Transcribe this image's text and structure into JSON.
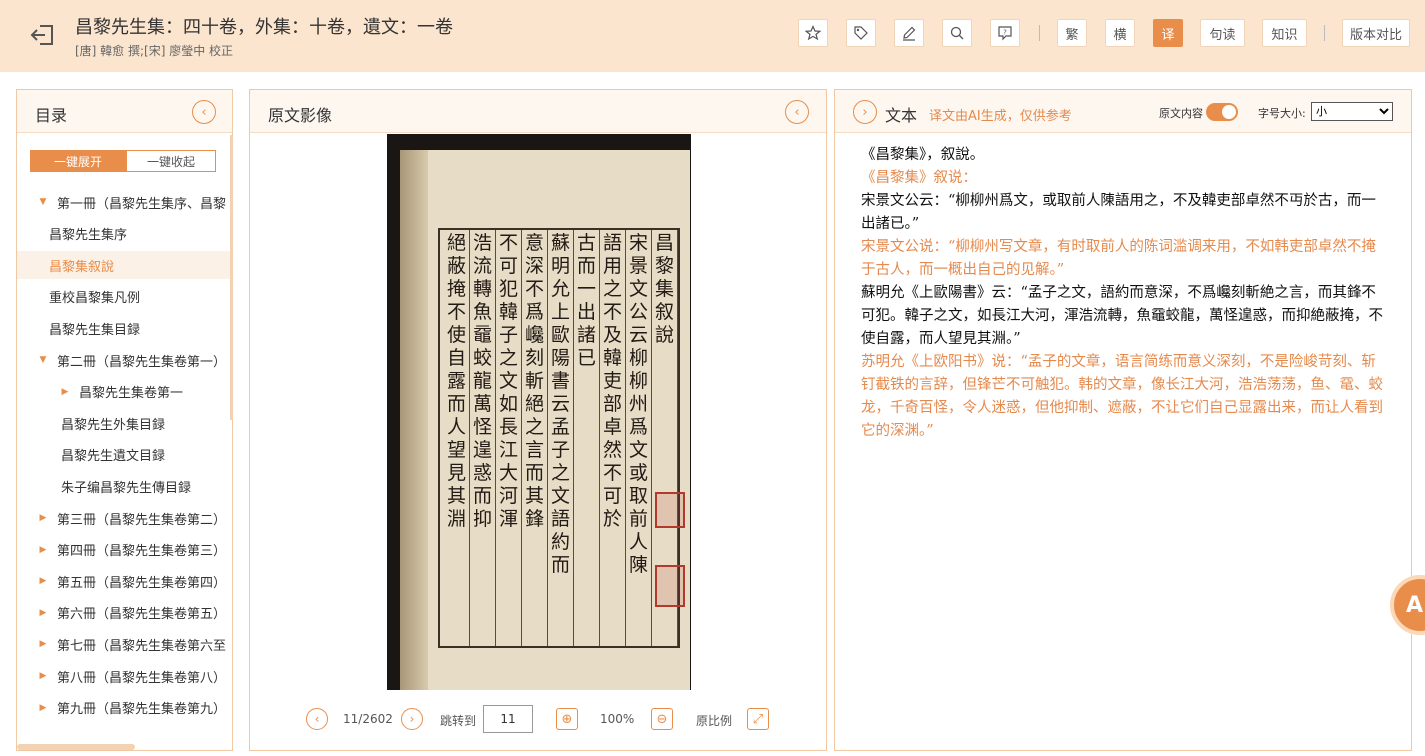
{
  "header": {
    "title": "昌黎先生集：四十卷，外集：十卷，遺文：一卷",
    "subtitle": "[唐] 韓愈 撰;[宋] 廖瑩中 校正",
    "toolbar": {
      "traditional": "繁",
      "horizontal": "横",
      "translate": "译",
      "punctuate": "句读",
      "knowledge": "知识",
      "compare": "版本对比"
    }
  },
  "toc": {
    "title": "目录",
    "expand_all": "一键展开",
    "collapse_all": "一键收起",
    "items": [
      {
        "label": "第一冊（昌黎先生集序、昌黎",
        "level": 0,
        "caret": "down"
      },
      {
        "label": "昌黎先生集序",
        "level": 1,
        "caret": ""
      },
      {
        "label": "昌黎集叙說",
        "level": 1,
        "caret": "",
        "selected": true
      },
      {
        "label": "重校昌黎集凡例",
        "level": 1,
        "caret": ""
      },
      {
        "label": "昌黎先生集目録",
        "level": 1,
        "caret": ""
      },
      {
        "label": "第二冊（昌黎先生集卷第一）",
        "level": 0,
        "caret": "down"
      },
      {
        "label": "昌黎先生集卷第一",
        "level": 2,
        "caret": "right"
      },
      {
        "label": "昌黎先生外集目録",
        "level": 2,
        "caret": ""
      },
      {
        "label": "昌黎先生遺文目録",
        "level": 2,
        "caret": ""
      },
      {
        "label": "朱子编昌黎先生傳目録",
        "level": 2,
        "caret": ""
      },
      {
        "label": "第三冊（昌黎先生集卷第二）",
        "level": 0,
        "caret": "right"
      },
      {
        "label": "第四冊（昌黎先生集卷第三）",
        "level": 0,
        "caret": "right"
      },
      {
        "label": "第五冊（昌黎先生集卷第四）",
        "level": 0,
        "caret": "right"
      },
      {
        "label": "第六冊（昌黎先生集卷第五）",
        "level": 0,
        "caret": "right"
      },
      {
        "label": "第七冊（昌黎先生集卷第六至",
        "level": 0,
        "caret": "right"
      },
      {
        "label": "第八冊（昌黎先生集卷第八）",
        "level": 0,
        "caret": "right"
      },
      {
        "label": "第九冊（昌黎先生集卷第九）",
        "level": 0,
        "caret": "right"
      }
    ]
  },
  "image_panel": {
    "title": "原文影像",
    "scan_columns": [
      "昌黎集叙說",
      "宋景文公云柳柳州爲文或取前人陳",
      "語用之不及韓吏部卓然不可於",
      "古而一出諸已",
      "蘇明允上歐陽書云孟子之文語約而",
      "意深不爲巉刻斬絕之言而其鋒",
      "不可犯韓子之文如長江大河渾",
      "浩流轉魚黿蛟龍萬怪遑惑而抑",
      "絕蔽掩不使自露而人望見其淵"
    ],
    "page_indicator": "11/2602",
    "jump_label": "跳转到",
    "jump_value": "11",
    "zoom": "100%",
    "original_scale": "原比例"
  },
  "text_panel": {
    "title": "文本",
    "notice": "译文由AI生成，仅供参考",
    "toggle_label": "原文内容",
    "toggle_on": true,
    "font_size_label": "字号大小:",
    "font_size_value": "小",
    "paragraphs": [
      {
        "type": "orig",
        "text": "《昌黎集》，叙說。"
      },
      {
        "type": "trans",
        "text": "《昌黎集》叙说："
      },
      {
        "type": "orig",
        "text": "宋景文公云：“柳柳州爲文，或取前人陳語用之，不及韓吏部卓然不丏於古，而一出諸已。”"
      },
      {
        "type": "trans",
        "text": "宋景文公说：“柳柳州写文章，有时取前人的陈词滥调来用，不如韩吏部卓然不掩于古人，而一概出自己的见解。”"
      },
      {
        "type": "orig",
        "text": "蘇明允《上歐陽書》云：“孟子之文，語約而意深，不爲巉刻斬絶之言，而其鋒不可犯。韓子之文，如長江大河，渾浩流轉，魚黿蛟龍，萬怪遑惑，而抑絶蔽掩，不使自露，而人望見其淵。”"
      },
      {
        "type": "trans",
        "text": "苏明允《上欧阳书》说：“孟子的文章，语言简练而意义深刻，不是险峻苛刻、斩钉截铁的言辞，但锋芒不可触犯。韩的文章，像长江大河，浩浩荡荡，鱼、鼋、蛟龙，千奇百怪，令人迷惑，但他抑制、遮蔽，不让它们自己显露出来，而让人看到它的深渊。”"
      }
    ]
  },
  "ai_badge": "AI",
  "colors": {
    "accent": "#e98d4a",
    "header_bg": "#fbe5cf",
    "translation": "#e58a4e"
  }
}
